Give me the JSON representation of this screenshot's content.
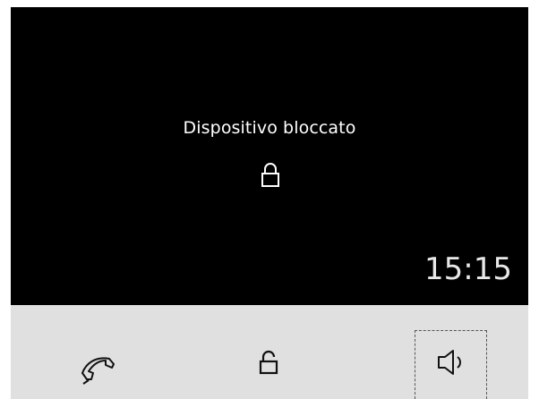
{
  "screen": {
    "message": "Dispositivo bloccato",
    "clock": "15:15",
    "lock_icon": "lock-icon"
  },
  "toolbar": {
    "buttons": [
      {
        "icon": "phone-handset-icon",
        "focused": false
      },
      {
        "icon": "unlock-icon",
        "focused": false
      },
      {
        "icon": "speaker-icon",
        "focused": true
      }
    ]
  },
  "colors": {
    "screen_bg": "#000000",
    "toolbar_bg": "#e0e0e0",
    "text": "#ffffff"
  }
}
